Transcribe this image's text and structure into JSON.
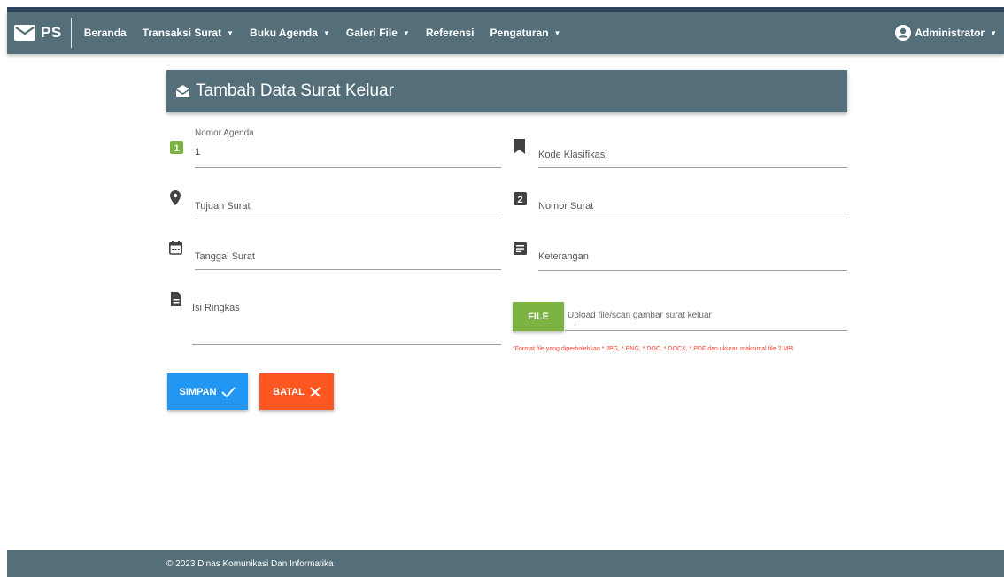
{
  "nav": {
    "brand": "PS",
    "items": [
      {
        "label": "Beranda"
      },
      {
        "label": "Transaksi Surat"
      },
      {
        "label": "Buku Agenda"
      },
      {
        "label": "Galeri File"
      },
      {
        "label": "Referensi"
      },
      {
        "label": "Pengaturan"
      }
    ],
    "user": "Administrator"
  },
  "card": {
    "title": "Tambah Data Surat Keluar"
  },
  "form": {
    "nomor_agenda": {
      "label": "Nomor Agenda",
      "value": "1"
    },
    "kode_klasifikasi": {
      "placeholder": "Kode Klasifikasi"
    },
    "tujuan_surat": {
      "placeholder": "Tujuan Surat"
    },
    "nomor_surat": {
      "placeholder": "Nomor Surat"
    },
    "tanggal_surat": {
      "placeholder": "Tanggal Surat"
    },
    "keterangan": {
      "placeholder": "Keterangan"
    },
    "isi_ringkas": {
      "placeholder": "Isi Ringkas"
    },
    "file": {
      "button": "FILE",
      "placeholder": "Upload file/scan gambar surat keluar",
      "note": "*Format file yang diperbolehkan *.JPG, *.PNG, *.DOC, *.DOCX, *.PDF dan ukuran maksimal file 2 MB!"
    }
  },
  "actions": {
    "save": "SIMPAN",
    "cancel": "BATAL"
  },
  "footer": {
    "text": "© 2023 Dinas Komunikasi Dan Informatika"
  },
  "colors": {
    "navbar": "#546e7a",
    "green": "#7cb342",
    "blue": "#2196f3",
    "orange": "#ff5722",
    "warning": "#f44336"
  }
}
